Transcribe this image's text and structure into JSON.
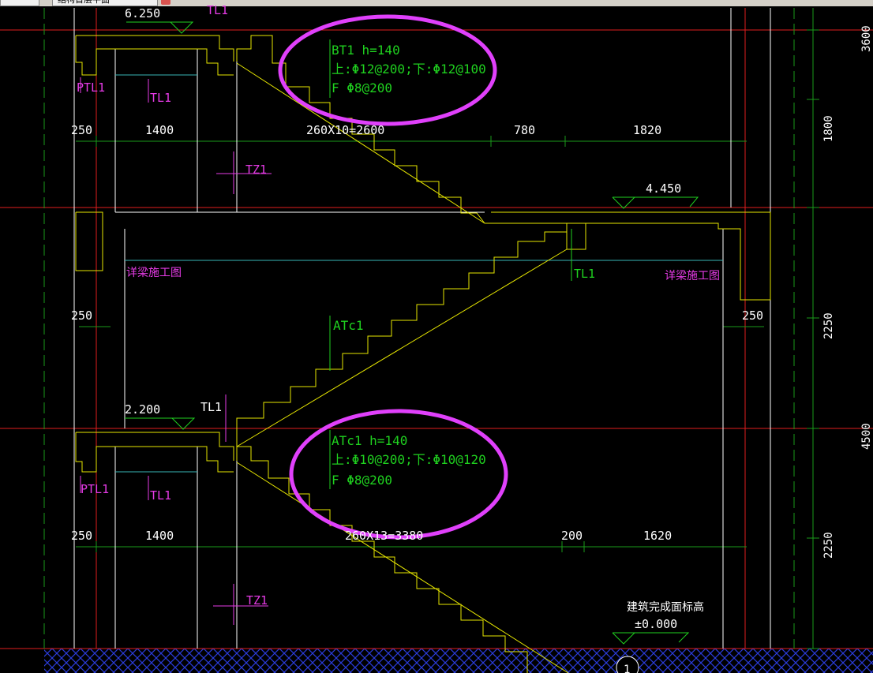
{
  "window": {
    "tab_left": "",
    "tab_active": "结构首层平面"
  },
  "colors": {
    "background": "#000000",
    "text_green": "#1fd11f",
    "text_white": "#ffffff",
    "text_magenta": "#e63be6",
    "slab_yellow": "#e6e600",
    "axis_red": "#e01e1e",
    "grid_green": "#1a9a1a",
    "beam_cyan": "#37b6b6",
    "ground_blue": "#2b3cd9",
    "highlight_ellipse": "#e040fb"
  },
  "labels": {
    "elev_top": "6.250",
    "elev_mid": "4.450",
    "elev_low": "2.200",
    "elev_ground_note": "建筑完成面标高",
    "elev_ground": "±0.000",
    "tl1_top": "TL1",
    "ptl1_top": "PTL1",
    "tl1_top_inner": "TL1",
    "tz1_upper": "TZ1",
    "tl1_mid": "TL1",
    "beam_note_left": "详梁施工图",
    "beam_note_right": "详梁施工图",
    "atc1_tag": "ATc1",
    "tl1_low": "TL1",
    "ptl1_low": "PTL1",
    "tl1_low_inner": "TL1",
    "tz1_lower": "TZ1",
    "axis_bubble": "1"
  },
  "dimensions": {
    "upper_row": [
      "250",
      "1400",
      "260X10=2600",
      "780",
      "1820"
    ],
    "mid_left": "250",
    "mid_right": "250",
    "lower_row": [
      "250",
      "1400",
      "260X13=3380",
      "200",
      "1620"
    ],
    "right_vertical": [
      "3600",
      "1800",
      "2250",
      "4500",
      "2250"
    ]
  },
  "annotations": {
    "bt1": {
      "line1": "BT1 h=140",
      "line2": "上:Φ12@200;下:Φ12@100",
      "line3": "F  Φ8@200"
    },
    "atc1": {
      "line1": "ATc1 h=140",
      "line2": "上:Φ10@200;下:Φ10@120",
      "line3": "F  Φ8@200"
    }
  }
}
